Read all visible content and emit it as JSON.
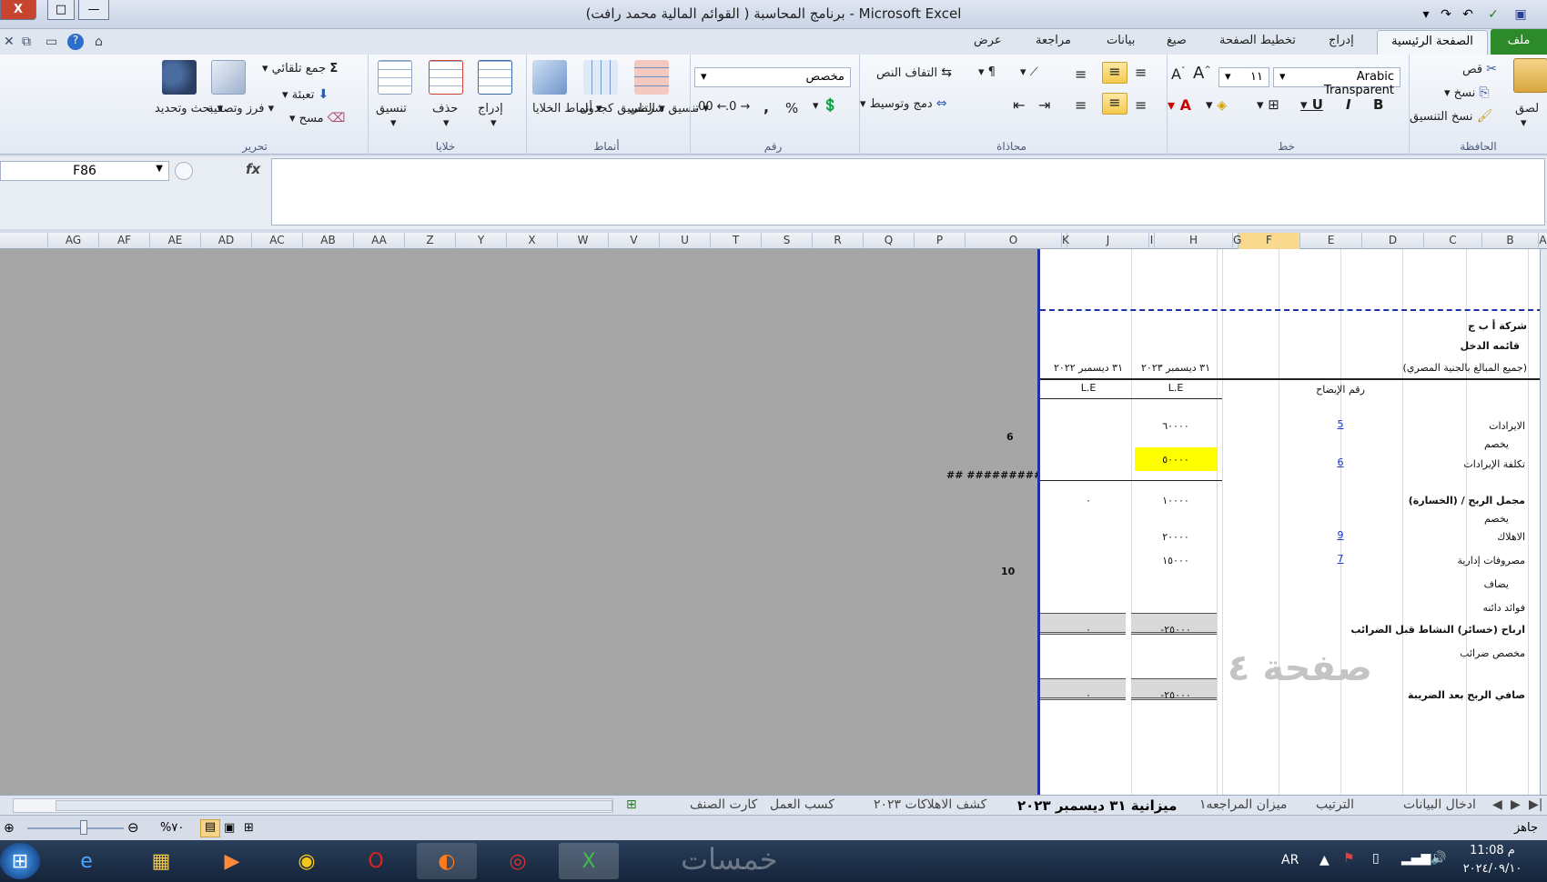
{
  "window": {
    "title": "برنامج المحاسبة ( القوائم المالية محمد رافت) - Microsoft Excel",
    "close": "X",
    "restore": "□",
    "minimize": "—"
  },
  "tabs": {
    "file": "ملف",
    "home": "الصفحة الرئيسية",
    "insert": "إدراج",
    "page_layout": "تخطيط الصفحة",
    "formulas": "صيغ",
    "data": "بيانات",
    "review": "مراجعة",
    "view": "عرض"
  },
  "ribbon": {
    "clipboard": {
      "label": "الحافظة",
      "paste": "لصق",
      "cut": "قص",
      "copy": "نسخ",
      "format_painter": "نسخ التنسيق"
    },
    "font": {
      "label": "خط",
      "font_name": "Arabic Transparent",
      "font_size": "١١",
      "bold": "B",
      "italic": "I",
      "underline": "U"
    },
    "alignment": {
      "label": "محاذاة",
      "wrap_text": "التفاف النص",
      "merge_center": "دمج وتوسيط"
    },
    "number": {
      "label": "رقم",
      "format": "مخصص",
      "percent": "%",
      "comma": ","
    },
    "styles": {
      "label": "أنماط",
      "conditional": "تنسيق شرطي",
      "as_table": "التنسيق كجدول",
      "cell_styles": "أنماط الخلايا"
    },
    "cells": {
      "label": "خلايا",
      "insert": "إدراج",
      "delete": "حذف",
      "format": "تنسيق"
    },
    "editing": {
      "label": "تحرير",
      "autosum": "جمع تلقائي",
      "fill": "تعبئة",
      "clear": "مسح",
      "sort": "فرز وتصفية",
      "find": "بحث وتحديد"
    }
  },
  "formula_bar": {
    "name_box": "F86",
    "fx": "fx",
    "value": ""
  },
  "columns": [
    "A",
    "B",
    "C",
    "D",
    "E",
    "F",
    "G",
    "H",
    "I",
    "J",
    "K",
    "O",
    "P",
    "Q",
    "R",
    "S",
    "T",
    "U",
    "V",
    "W",
    "X",
    "Y",
    "Z",
    "AA",
    "AB",
    "AC",
    "AD",
    "AE",
    "AF",
    "AG"
  ],
  "selected_column": "F",
  "report": {
    "company": "شركة أ ب ج",
    "statement": "قائمه الدخل",
    "currency_note": "(جميع المبالغ بالجنية المصري)",
    "col_note": "رقم الإيضاح",
    "col_2023": "٣١ ديسمبر ٢٠٢٣",
    "col_2022": "٣١ ديسمبر ٢٠٢٢",
    "unit_2023": "L.E",
    "unit_2022": "L.E",
    "rows": [
      {
        "label": "الايرادات",
        "note": "5",
        "v2023": "٦٠٠٠٠",
        "v2022": "",
        "side": "6"
      },
      {
        "label": "يخصم",
        "note": "",
        "v2023": "",
        "v2022": "",
        "side": ""
      },
      {
        "label": "تكلفة الإيرادات",
        "note": "6",
        "v2023": "٥٠٠٠٠",
        "v2022": "",
        "side": "## ###########"
      },
      {
        "label": "مجمل الربح / (الخسارة)",
        "note": "",
        "v2023": "١٠٠٠٠",
        "v2022": "٠",
        "side": ""
      },
      {
        "label": "يخصم",
        "note": "",
        "v2023": "",
        "v2022": "",
        "side": ""
      },
      {
        "label": "الاهلاك",
        "note": "9",
        "v2023": "٢٠٠٠٠",
        "v2022": "",
        "side": ""
      },
      {
        "label": "مصروفات إدارية",
        "note": "7",
        "v2023": "١٥٠٠٠",
        "v2022": "",
        "side": "10"
      },
      {
        "label": "يضاف",
        "note": "",
        "v2023": "",
        "v2022": "",
        "side": ""
      },
      {
        "label": "فوائد دائنه",
        "note": "",
        "v2023": "",
        "v2022": "",
        "side": ""
      },
      {
        "label": "ارباح (خسائر) النشاط قبل الضرائب",
        "note": "",
        "v2023": "-٢٥٠٠٠",
        "v2022": "٠",
        "side": ""
      },
      {
        "label": "مخصص ضرائب",
        "note": "",
        "v2023": "",
        "v2022": "",
        "side": ""
      },
      {
        "label": "صافي الربح بعد الضريبة",
        "note": "",
        "v2023": "-٢٥٠٠٠",
        "v2022": "٠",
        "side": ""
      }
    ],
    "watermark": "صفحة ٤"
  },
  "sheet_tabs": [
    "ادخال البيانات",
    "الترتيب",
    "ميزان المراجعه١",
    "ميزانية ٣١ ديسمبر ٢٠٢٣",
    "كشف الاهلاكات ٢٠٢٣",
    "كسب العمل",
    "كارت الصنف"
  ],
  "active_sheet": "ميزانية ٣١ ديسمبر ٢٠٢٣",
  "status": {
    "ready": "جاهز",
    "zoom": "%٧٠"
  },
  "taskbar": {
    "lang": "AR",
    "time": "11:08 م",
    "date": "٢٠٢٤/٠٩/١٠",
    "watermark": "خمسات"
  }
}
